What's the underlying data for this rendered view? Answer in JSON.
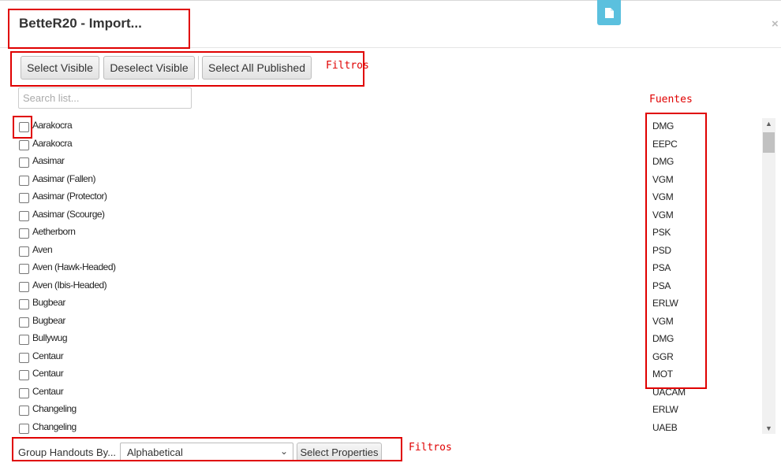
{
  "dialog": {
    "title": "BetteR20 - Import...",
    "close_glyph": "×"
  },
  "toolbar": {
    "select_visible": "Select Visible",
    "deselect_visible": "Deselect Visible",
    "select_all_published": "Select All Published"
  },
  "search": {
    "placeholder": "Search list..."
  },
  "list": {
    "items": [
      {
        "name": "Aarakocra",
        "source": "DMG"
      },
      {
        "name": "Aarakocra",
        "source": "EEPC"
      },
      {
        "name": "Aasimar",
        "source": "DMG"
      },
      {
        "name": "Aasimar (Fallen)",
        "source": "VGM"
      },
      {
        "name": "Aasimar (Protector)",
        "source": "VGM"
      },
      {
        "name": "Aasimar (Scourge)",
        "source": "VGM"
      },
      {
        "name": "Aetherborn",
        "source": "PSK"
      },
      {
        "name": "Aven",
        "source": "PSD"
      },
      {
        "name": "Aven (Hawk-Headed)",
        "source": "PSA"
      },
      {
        "name": "Aven (Ibis-Headed)",
        "source": "PSA"
      },
      {
        "name": "Bugbear",
        "source": "ERLW"
      },
      {
        "name": "Bugbear",
        "source": "VGM"
      },
      {
        "name": "Bullywug",
        "source": "DMG"
      },
      {
        "name": "Centaur",
        "source": "GGR"
      },
      {
        "name": "Centaur",
        "source": "MOT"
      },
      {
        "name": "Centaur",
        "source": "UACAM"
      },
      {
        "name": "Changeling",
        "source": "ERLW"
      },
      {
        "name": "Changeling",
        "source": "UAEB"
      }
    ]
  },
  "footer": {
    "group_label": "Group Handouts By...",
    "group_value": "Alphabetical",
    "select_properties": "Select Properties"
  },
  "annotations": {
    "filters_top": "Filtros",
    "sources": "Fuentes",
    "filters_bottom": "Filtros",
    "color": "#e00000"
  }
}
